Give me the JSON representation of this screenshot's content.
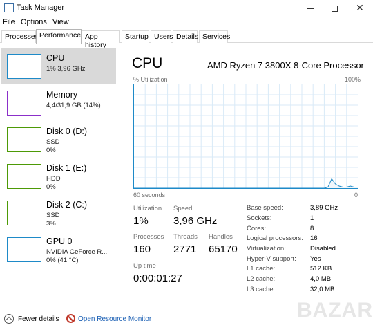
{
  "window": {
    "title": "Task Manager",
    "icon": "task-manager-icon"
  },
  "menu": [
    "File",
    "Options",
    "View"
  ],
  "tabs": [
    "Processes",
    "Performance",
    "App history",
    "Startup",
    "Users",
    "Details",
    "Services"
  ],
  "active_tab": "Performance",
  "sidebar": [
    {
      "name": "CPU",
      "lines": [
        "1% 3,96 GHz"
      ],
      "color": "#1e8ac8"
    },
    {
      "name": "Memory",
      "lines": [
        "4,4/31,9 GB (14%)"
      ],
      "color": "#8b2fc9"
    },
    {
      "name": "Disk 0 (D:)",
      "lines": [
        "SSD",
        "0%"
      ],
      "color": "#4d9a06"
    },
    {
      "name": "Disk 1 (E:)",
      "lines": [
        "HDD",
        "0%"
      ],
      "color": "#4d9a06"
    },
    {
      "name": "Disk 2 (C:)",
      "lines": [
        "SSD",
        "3%"
      ],
      "color": "#4d9a06"
    },
    {
      "name": "GPU 0",
      "lines": [
        "NVIDIA GeForce R...",
        "0% (41 °C)"
      ],
      "color": "#1e8ac8"
    }
  ],
  "main": {
    "title": "CPU",
    "processor": "AMD Ryzen 7 3800X 8-Core Processor",
    "graph_label_left": "% Utilization",
    "graph_label_right": "100%",
    "graph_footer_left": "60 seconds",
    "graph_footer_right": "0",
    "stats": {
      "utilization_label": "Utilization",
      "utilization": "1%",
      "speed_label": "Speed",
      "speed": "3,96 GHz",
      "processes_label": "Processes",
      "processes": "160",
      "threads_label": "Threads",
      "threads": "2771",
      "handles_label": "Handles",
      "handles": "65170",
      "uptime_label": "Up time",
      "uptime": "0:00:01:27"
    },
    "specs": [
      {
        "label": "Base speed:",
        "value": "3,89 GHz"
      },
      {
        "label": "Sockets:",
        "value": "1"
      },
      {
        "label": "Cores:",
        "value": "8"
      },
      {
        "label": "Logical processors:",
        "value": "16"
      },
      {
        "label": "Virtualization:",
        "value": "Disabled"
      },
      {
        "label": "Hyper-V support:",
        "value": "Yes"
      },
      {
        "label": "L1 cache:",
        "value": "512 KB"
      },
      {
        "label": "L2 cache:",
        "value": "4,0 MB"
      },
      {
        "label": "L3 cache:",
        "value": "32,0 MB"
      }
    ]
  },
  "footer": {
    "fewer_details": "Fewer details",
    "open_monitor": "Open Resource Monitor"
  },
  "watermark": "BAZAR",
  "chart_data": {
    "type": "area",
    "xlabel": "60 seconds",
    "ylabel": "% Utilization",
    "ylim": [
      0,
      100
    ],
    "xlim": [
      60,
      0
    ],
    "series": [
      {
        "values": [
          0,
          0,
          0,
          0,
          0,
          0,
          0,
          0,
          0,
          0,
          0,
          0,
          0,
          0,
          0,
          0,
          0,
          0,
          0,
          0,
          0,
          0,
          0,
          0,
          0,
          0,
          0,
          0,
          0,
          0,
          0,
          0,
          0,
          0,
          0,
          0,
          0,
          0,
          0,
          0,
          0,
          0,
          0,
          0,
          0,
          0,
          0,
          0,
          0,
          0,
          0,
          0,
          1,
          9,
          4,
          2,
          1,
          1,
          2,
          1,
          1
        ]
      }
    ],
    "color": "#1e8ac8",
    "grid": true
  }
}
